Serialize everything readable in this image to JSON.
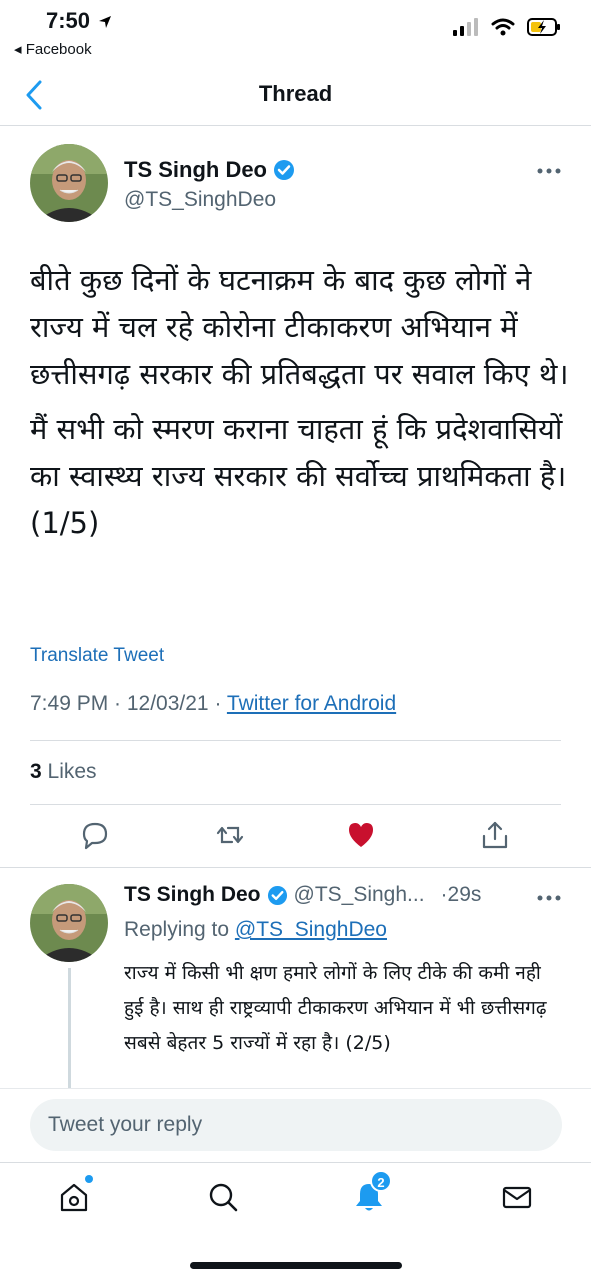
{
  "status": {
    "time": "7:50",
    "back_app": "◂ Facebook"
  },
  "nav": {
    "title": "Thread"
  },
  "main_tweet": {
    "name": "TS Singh Deo",
    "handle": "@TS_SinghDeo",
    "paragraphs": [
      "बीते कुछ दिनों के घटनाक्रम के बाद कुछ लोगों ने राज्य में चल रहे कोरोना टीकाकरण अभियान में छत्तीसगढ़ सरकार की प्रतिबद्धता पर सवाल किए थे।",
      "मैं सभी को स्मरण कराना चाहता हूं कि प्रदेशवासियों का स्वास्थ्य राज्य सरकार की सर्वोच्च प्राथमिकता है। (1/5)"
    ],
    "translate_label": "Translate Tweet",
    "timestamp": "7:49 PM · 12/03/21 · ",
    "source": "Twitter for Android",
    "likes_count": "3",
    "likes_label": " Likes"
  },
  "reply_tweet": {
    "name": "TS Singh Deo",
    "handle": "@TS_Singh...",
    "time": "·29s",
    "replying_prefix": "Replying to ",
    "replying_to": "@TS_SinghDeo",
    "body": "राज्य में किसी भी क्षण हमारे लोगों के लिए टीके की कमी नही हुई है। साथ ही राष्ट्रव्यापी टीकाकरण अभियान में भी छत्तीसगढ़ सबसे बेहतर 5 राज्यों में रहा है। (2/5)"
  },
  "reply_input": {
    "placeholder": "Tweet your reply"
  },
  "tabs": {
    "notifications_badge": "2"
  },
  "colors": {
    "accent": "#1d9bf0",
    "link": "#1d6fb8",
    "like": "#c8102e",
    "verified": "#1d9bf0"
  }
}
